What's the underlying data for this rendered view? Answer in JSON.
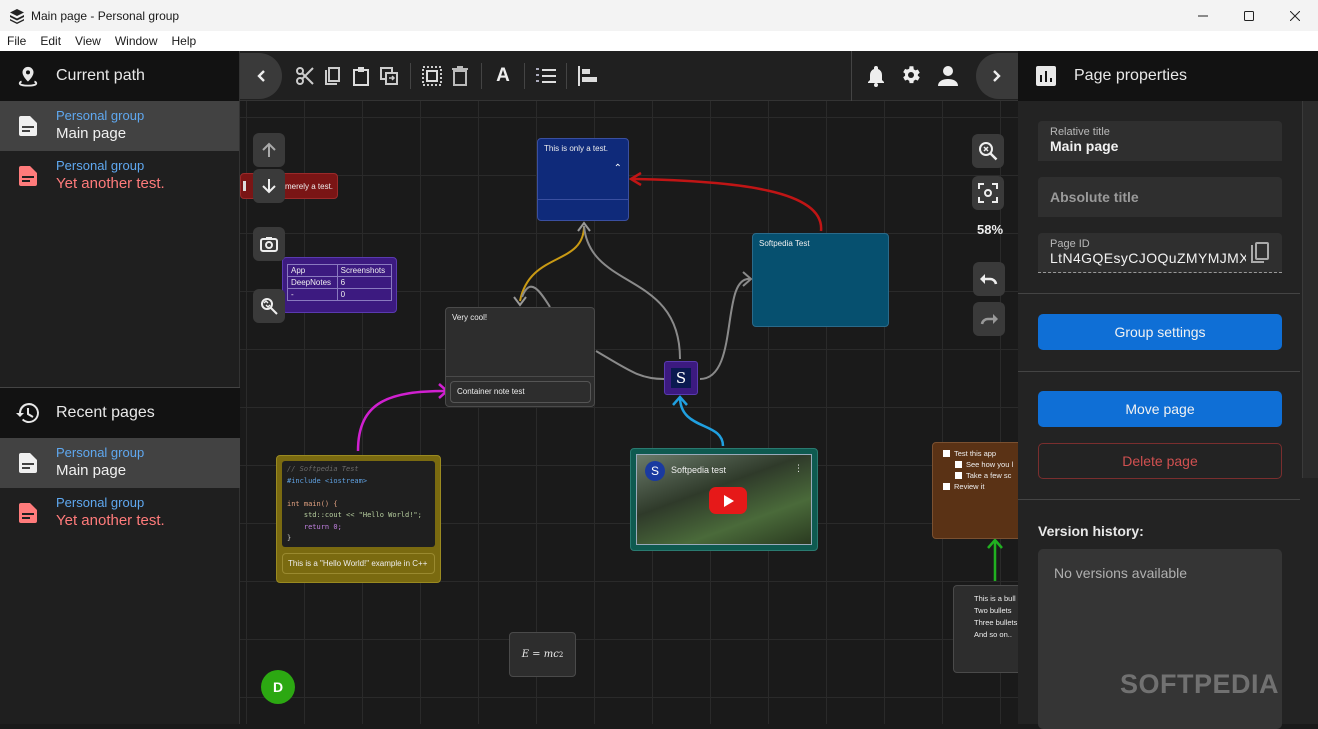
{
  "window": {
    "title": "Main page - Personal group"
  },
  "menu": [
    "File",
    "Edit",
    "View",
    "Window",
    "Help"
  ],
  "left_sidebar": {
    "current_path": {
      "header": "Current path",
      "items": [
        {
          "group": "Personal group",
          "title": "Main page",
          "active": true,
          "color": "#f0f0f0"
        },
        {
          "group": "Personal group",
          "title": "Yet another test.",
          "active": false,
          "color": "#ff7b7b"
        }
      ]
    },
    "recent_pages": {
      "header": "Recent pages",
      "items": [
        {
          "group": "Personal group",
          "title": "Main page",
          "active": true,
          "color": "#f0f0f0"
        },
        {
          "group": "Personal group",
          "title": "Yet another test.",
          "active": false,
          "color": "#ff7b7b"
        }
      ]
    }
  },
  "toolbar": {
    "left_icons": [
      "chevron-left-icon",
      "cut-icon",
      "copy-icon",
      "paste-icon",
      "duplicate-icon",
      "select-all-icon",
      "delete-icon",
      "text-format-icon",
      "numbered-list-icon",
      "align-left-icon"
    ],
    "right_icons": [
      "bell-icon",
      "gear-icon",
      "user-icon",
      "chevron-right-icon"
    ]
  },
  "canvas": {
    "zoom_level": "58%",
    "notes": {
      "red_note": "merely a test.",
      "blue_note": "This is only a test.",
      "softpedia_note": "Softpedia Test",
      "very_cool_note": "Very cool!",
      "container_child": "Container note test",
      "code_caption": "This is a \"Hello World!\" example in C++",
      "video_title": "Softpedia test",
      "formula": "E = mc",
      "formula_sup": "2",
      "link_logo": "S",
      "avatar_initial": "D"
    },
    "table": {
      "headers": [
        "App",
        "Screenshots"
      ],
      "rows": [
        [
          "DeepNotes",
          "6"
        ],
        [
          "-",
          "0"
        ]
      ]
    },
    "code_lines": [
      "// Softpedia Test",
      "#include <iostream>",
      "",
      "int main() {",
      "    std::cout << \"Hello World!\";",
      "    return 0;",
      "}"
    ],
    "checklist": [
      {
        "label": "Test this app",
        "level": 0
      },
      {
        "label": "See how you l",
        "level": 1
      },
      {
        "label": "Take a few sc",
        "level": 1
      },
      {
        "label": "Review it",
        "level": 0
      }
    ],
    "bullets": [
      "This is a bull list",
      "Two bullets",
      "Three bullets",
      "And so on.."
    ]
  },
  "right_panel": {
    "header": "Page properties",
    "relative_title_label": "Relative title",
    "relative_title_value": "Main page",
    "absolute_title_placeholder": "Absolute title",
    "page_id_label": "Page ID",
    "page_id_value": "LtN4GQEsyCJOQuZMYMJMX",
    "group_settings": "Group settings",
    "move_page": "Move page",
    "delete_page": "Delete page",
    "version_history_label": "Version history:",
    "no_versions": "No versions available"
  },
  "watermark": "SOFTPEDIA"
}
